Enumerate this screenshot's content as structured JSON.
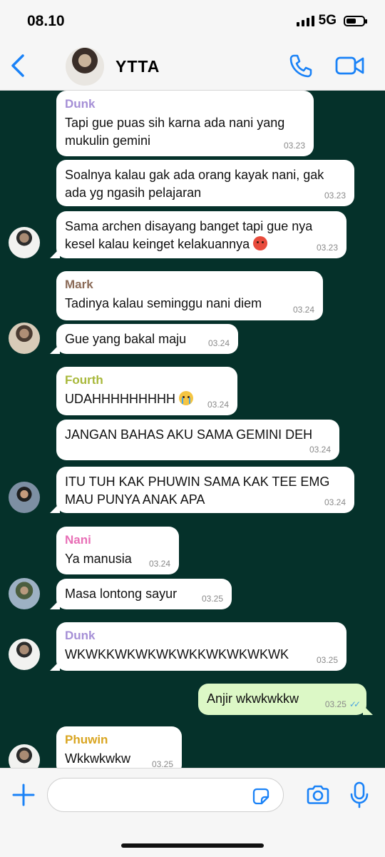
{
  "status_bar": {
    "time": "08.10",
    "network": "5G",
    "battery_level": 0.6
  },
  "header": {
    "title": "YTTA",
    "back_icon": "chevron-left-icon",
    "call_icon": "phone-icon",
    "video_icon": "video-camera-icon"
  },
  "colors": {
    "accent": "#1a82f7",
    "chat_background": "#05312a",
    "incoming_bubble": "#ffffff",
    "outgoing_bubble": "#dcf8c6"
  },
  "messages": [
    {
      "sender": "Dunk",
      "sender_color": "#a58fd6",
      "text": "Tapi gue puas sih karna ada nani yang mukulin gemini",
      "time": "03.23",
      "direction": "in"
    },
    {
      "text": "Soalnya kalau gak ada orang kayak nani, gak ada yg ngasih pelajaran",
      "time": "03.23",
      "direction": "in"
    },
    {
      "text": "Sama archen disayang banget tapi gue nya kesel kalau keinget kelakuannya",
      "emoji": "angry-face-emoji",
      "time": "03.23",
      "direction": "in"
    },
    {
      "sender": "Mark",
      "sender_color": "#8b6b58",
      "text": "Tadinya kalau seminggu nani diem",
      "time": "03.24",
      "direction": "in"
    },
    {
      "text": "Gue yang bakal maju",
      "time": "03.24",
      "direction": "in"
    },
    {
      "sender": "Fourth",
      "sender_color": "#a8b83a",
      "text": "UDAHHHHHHHHH",
      "emoji": "crying-face-emoji",
      "time": "03.24",
      "direction": "in"
    },
    {
      "text": "JANGAN BAHAS AKU SAMA GEMINI DEH",
      "time": "03.24",
      "direction": "in"
    },
    {
      "text": "ITU TUH KAK PHUWIN SAMA KAK TEE EMG MAU PUNYA ANAK APA",
      "time": "03.24",
      "direction": "in"
    },
    {
      "sender": "Nani",
      "sender_color": "#e86fb6",
      "text": "Ya manusia",
      "time": "03.24",
      "direction": "in"
    },
    {
      "text": "Masa lontong sayur",
      "time": "03.25",
      "direction": "in"
    },
    {
      "sender": "Dunk",
      "sender_color": "#a58fd6",
      "text": "WKWKKWKWKWKWKKWKWKWKWK",
      "time": "03.25",
      "direction": "in"
    },
    {
      "text": "Anjir wkwkwkkw",
      "time": "03.25",
      "direction": "out",
      "status": "read"
    },
    {
      "sender": "Phuwin",
      "sender_color": "#d9a521",
      "text": "Wkkwkwkw",
      "time": "03.25",
      "direction": "in"
    }
  ],
  "input": {
    "placeholder": "",
    "value": ""
  },
  "input_icons": {
    "add": "plus-icon",
    "sticker": "sticker-icon",
    "camera": "camera-icon",
    "mic": "microphone-icon"
  }
}
